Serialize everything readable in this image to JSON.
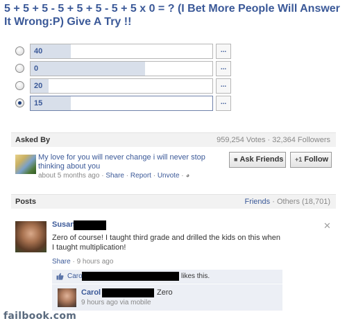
{
  "question": "5 + 5 + 5 - 5 + 5 + 5 - 5 + 5 x 0 = ? (I Bet More People Will Answer It Wrong:P) Give A Try !!",
  "options": [
    {
      "label": "40",
      "fill": 0.22,
      "checked": false
    },
    {
      "label": "0",
      "fill": 0.63,
      "checked": false
    },
    {
      "label": "20",
      "fill": 0.1,
      "checked": false
    },
    {
      "label": "15",
      "fill": 0.22,
      "checked": true
    }
  ],
  "more_label": "...",
  "asked_by": {
    "heading": "Asked By",
    "stats": "959,254 Votes · 32,364 Followers",
    "asker_text": "My love for you will never change i will never stop thinking about you",
    "time": "about 5 months ago",
    "share": "Share",
    "report": "Report",
    "unvote": "Unvote",
    "sep": "·",
    "ask_friends": "Ask Friends",
    "follow": "Follow"
  },
  "posts": {
    "heading": "Posts",
    "friends": "Friends",
    "others": "Others (18,701)"
  },
  "post": {
    "name": "Susan",
    "text": "Zero of course! I taught third grade and drilled the kids on this when I taught multiplication!",
    "share": "Share",
    "time": "9 hours ago",
    "like_name": "Carol",
    "like_text": "likes this.",
    "comment_name": "Carol",
    "comment_text": "Zero",
    "comment_meta": "9 hours ago via mobile"
  },
  "watermark": "failbook.com",
  "colors": {
    "link": "#3b5998",
    "fill": "#d8dfea",
    "bar": "#f2f2f2"
  }
}
